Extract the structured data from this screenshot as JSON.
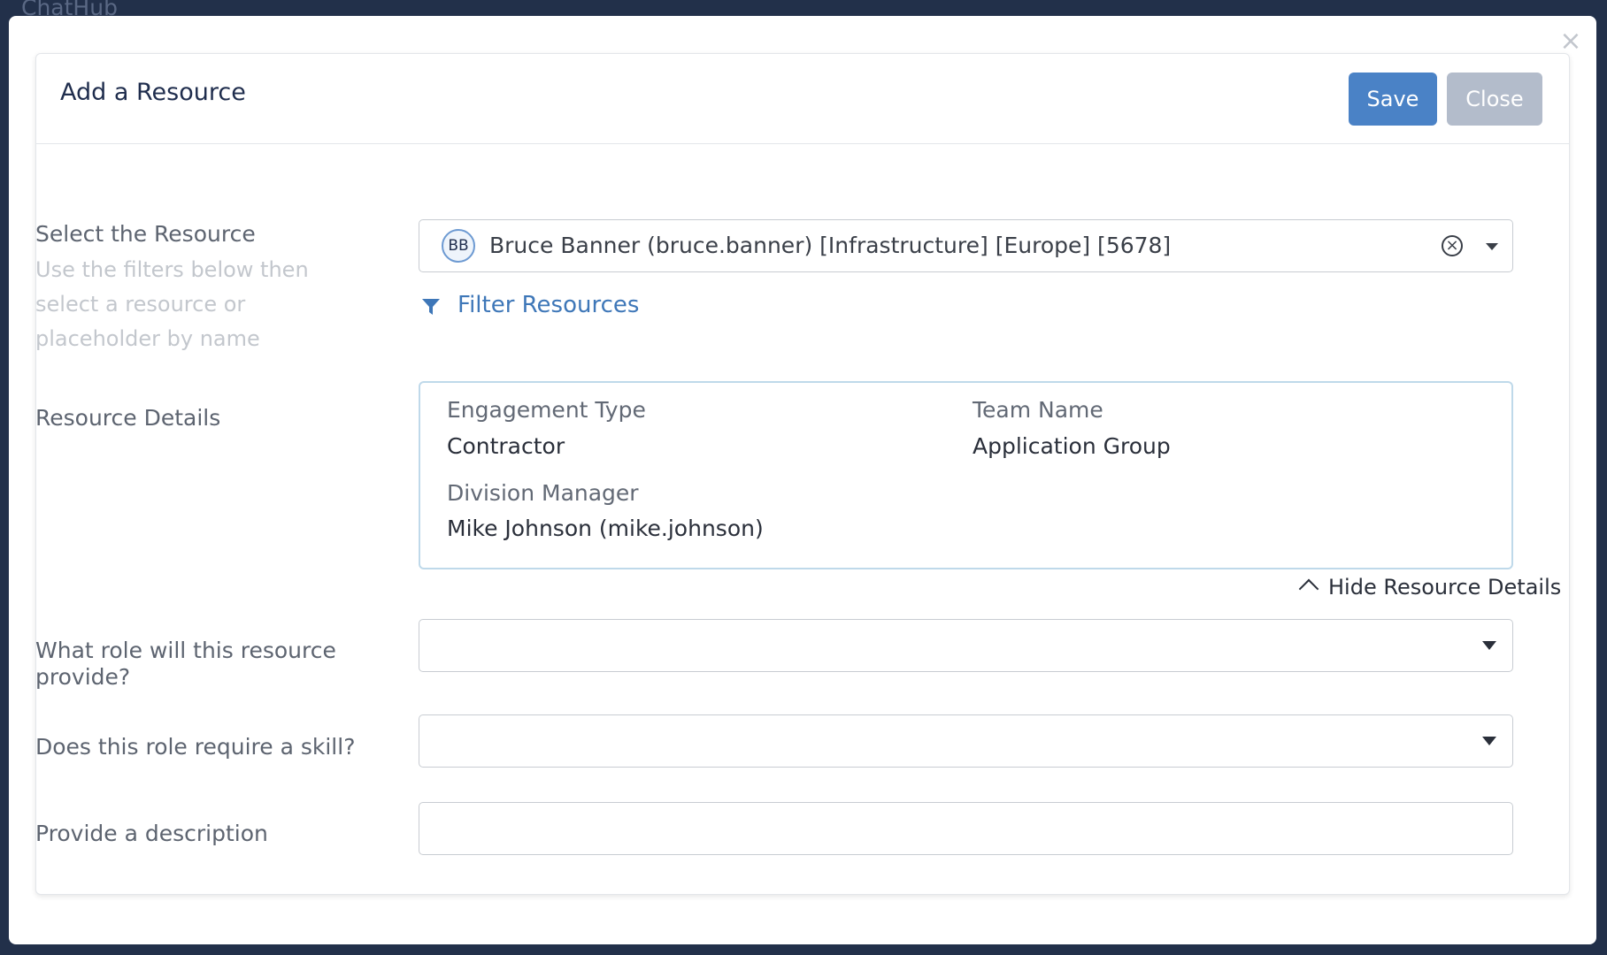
{
  "app": {
    "title": "ChatHub"
  },
  "modal": {
    "title": "Add a Resource",
    "save_label": "Save",
    "close_label": "Close",
    "close_icon": "×"
  },
  "resource": {
    "label": "Select the Resource",
    "hint": "Use the filters below then select a resource or placeholder by name",
    "avatar_initials": "BB",
    "selected_value": "Bruce Banner (bruce.banner) [Infrastructure] [Europe] [5678]",
    "filter_label": "Filter Resources"
  },
  "details": {
    "label": "Resource Details",
    "engagement_type_label": "Engagement Type",
    "engagement_type_value": "Contractor",
    "team_name_label": "Team Name",
    "team_name_value": "Application Group",
    "division_manager_label": "Division Manager",
    "division_manager_value": "Mike Johnson (mike.johnson)",
    "hide_label": "Hide Resource Details"
  },
  "role": {
    "label": "What role will this resource provide?",
    "value": ""
  },
  "skill": {
    "label": "Does this role require a skill?",
    "value": ""
  },
  "description": {
    "label": "Provide a description",
    "value": ""
  },
  "colors": {
    "primary": "#4a82c6",
    "disabled": "#b3bccb",
    "link": "#3e77b8",
    "backdrop": "#22304a"
  }
}
